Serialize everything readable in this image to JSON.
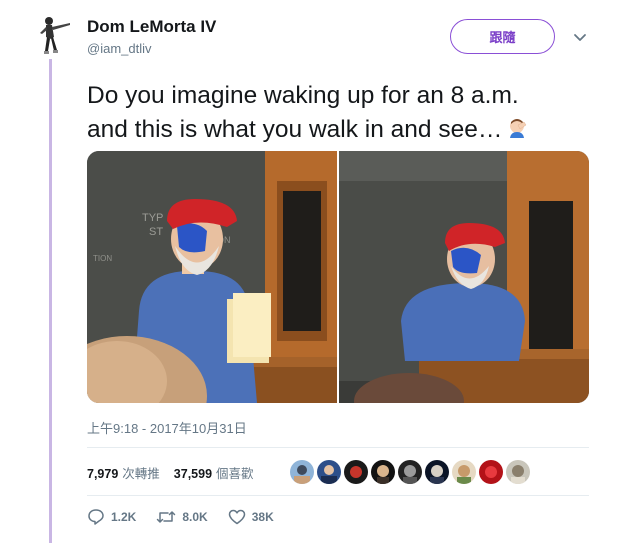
{
  "author": {
    "name": "Dom LeMorta IV",
    "handle": "@iam_dtliv"
  },
  "follow_label": "跟隨",
  "tweet": {
    "line1": "Do you imagine waking up for an 8 a.m.",
    "line2": "and this is what you walk in and see…",
    "emoji": "facepalm-emoji"
  },
  "timestamp": "上午9:18 - 2017年10月31日",
  "stats": {
    "retweets_count": "7,979",
    "retweets_label": "次轉推",
    "likes_count": "37,599",
    "likes_label": "個喜歡"
  },
  "actions": {
    "replies": "1.2K",
    "retweets": "8.0K",
    "likes": "38K"
  },
  "colors": {
    "accent": "#7b3fc8",
    "thread_line": "#c9b6e4",
    "secondary_text": "#657786"
  }
}
